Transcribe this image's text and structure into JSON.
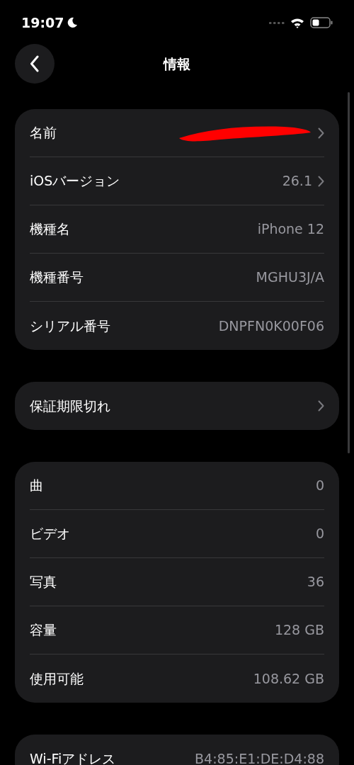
{
  "status_bar": {
    "time": "19:07"
  },
  "nav": {
    "title": "情報"
  },
  "groups": [
    {
      "rows": [
        {
          "label": "名前",
          "redacted": true,
          "chevron": true
        },
        {
          "label": "iOSバージョン",
          "value": "26.1",
          "chevron": true
        },
        {
          "label": "機種名",
          "value": "iPhone 12",
          "chevron": false
        },
        {
          "label": "機種番号",
          "value": "MGHU3J/A",
          "chevron": false
        },
        {
          "label": "シリアル番号",
          "value": "DNPFN0K00F06",
          "chevron": false
        }
      ]
    },
    {
      "rows": [
        {
          "label": "保証期限切れ",
          "chevron": true
        }
      ]
    },
    {
      "rows": [
        {
          "label": "曲",
          "value": "0",
          "chevron": false
        },
        {
          "label": "ビデオ",
          "value": "0",
          "chevron": false
        },
        {
          "label": "写真",
          "value": "36",
          "chevron": false
        },
        {
          "label": "容量",
          "value": "128 GB",
          "chevron": false
        },
        {
          "label": "使用可能",
          "value": "108.62 GB",
          "chevron": false
        }
      ]
    },
    {
      "rows": [
        {
          "label": "Wi-Fiアドレス",
          "value": "B4:85:E1:DE:D4:88",
          "chevron": false
        }
      ]
    }
  ]
}
